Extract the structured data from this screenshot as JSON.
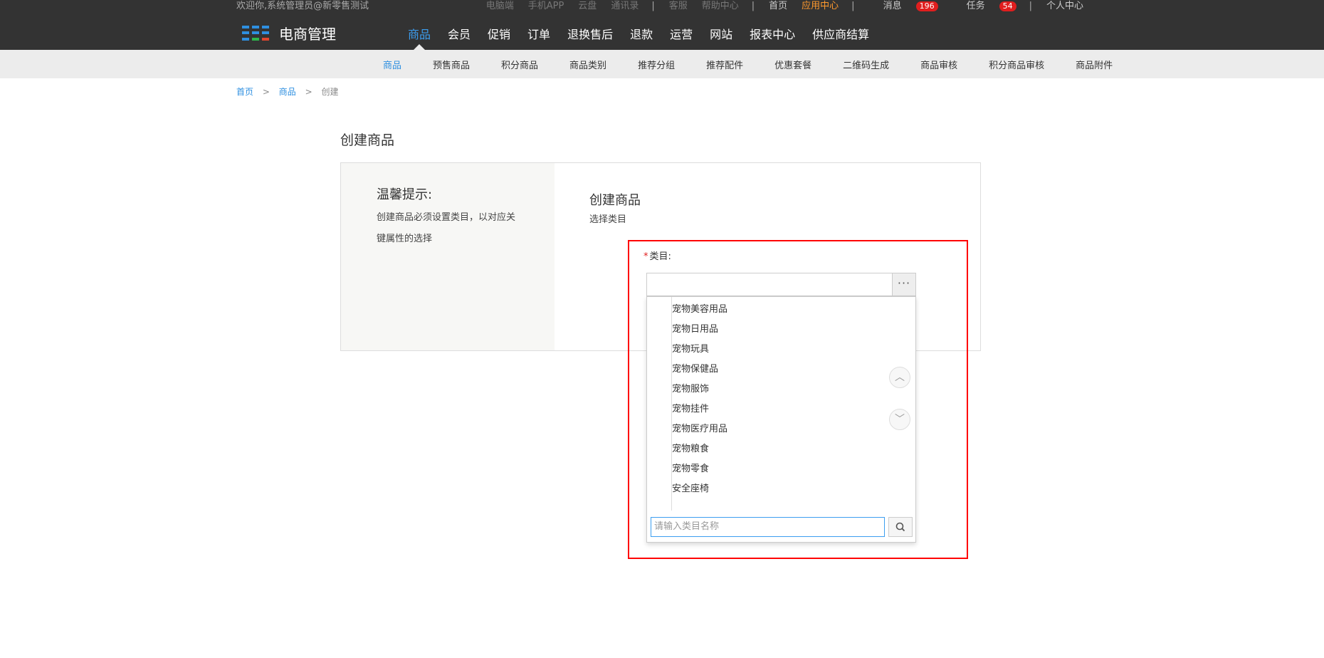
{
  "topbar": {
    "welcome": "欢迎你,系统管理员@新零售测试",
    "links": {
      "pc": "电脑端",
      "app": "手机APP",
      "cloud": "云盘",
      "contacts": "通讯录",
      "service": "客服",
      "help": "帮助中心",
      "home": "首页",
      "appcenter": "应用中心",
      "messages": "消息",
      "messages_count": "196",
      "tasks": "任务",
      "tasks_count": "54",
      "profile": "个人中心"
    },
    "separator": "|"
  },
  "logo": {
    "text": "电商管理"
  },
  "mainnav": [
    "商品",
    "会员",
    "促销",
    "订单",
    "退换售后",
    "退款",
    "运营",
    "网站",
    "报表中心",
    "供应商结算"
  ],
  "subnav": [
    "商品",
    "预售商品",
    "积分商品",
    "商品类别",
    "推荐分组",
    "推荐配件",
    "优惠套餐",
    "二维码生成",
    "商品审核",
    "积分商品审核",
    "商品附件"
  ],
  "breadcrumb": {
    "home": "首页",
    "goods": "商品",
    "current": "创建",
    "sep": ">"
  },
  "page": {
    "title": "创建商品"
  },
  "tips": {
    "title": "温馨提示:",
    "body": "创建商品必须设置类目，以对应关键属性的选择"
  },
  "form": {
    "title": "创建商品",
    "subtitle": "选择类目",
    "required_mark": "*",
    "category_label": "类目:",
    "browse_button": "···"
  },
  "dropdown": {
    "items": [
      "宠物美容用品",
      "宠物日用品",
      "宠物玩具",
      "宠物保健品",
      "宠物服饰",
      "宠物挂件",
      "宠物医疗用品",
      "宠物粮食",
      "宠物零食",
      "安全座椅"
    ],
    "search_placeholder": "请输入类目名称",
    "scroll_up": "︿",
    "scroll_down": "﹀"
  }
}
